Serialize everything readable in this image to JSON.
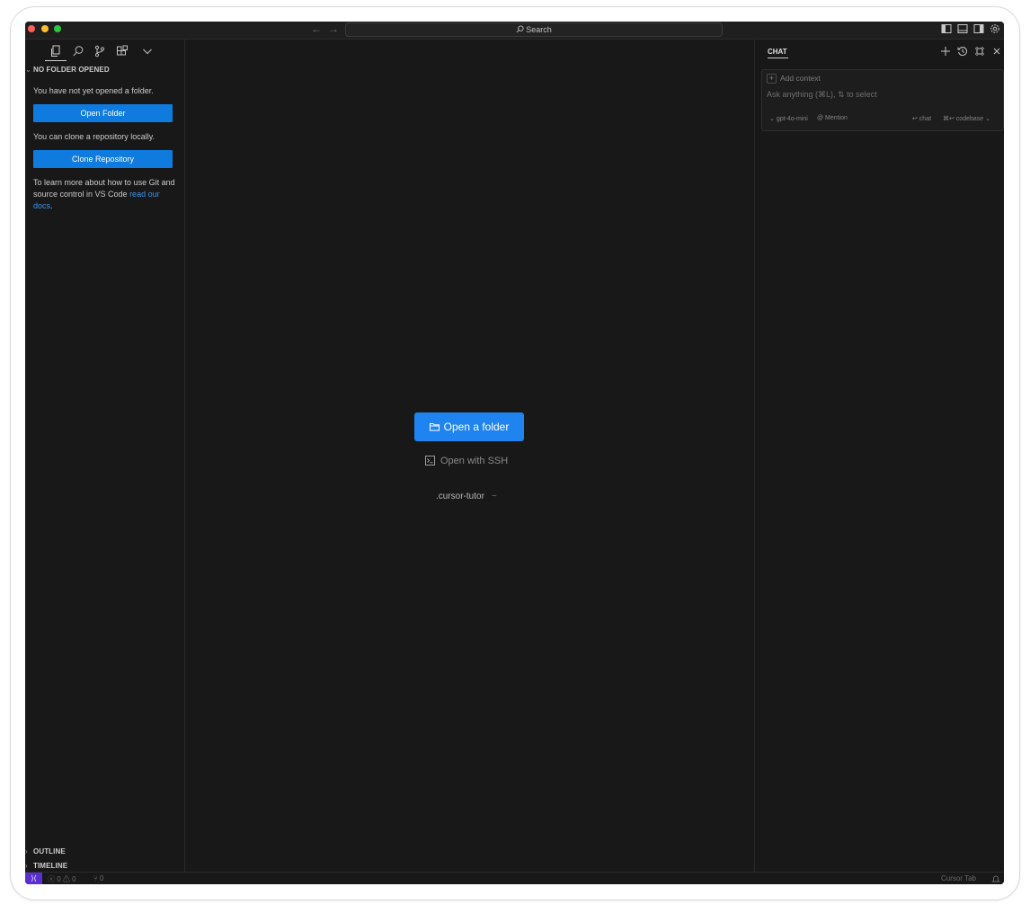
{
  "titlebar": {
    "back_arrow": "←",
    "forward_arrow": "→",
    "search_label": "Search",
    "right_icons": [
      "toggle-primary-sidebar-icon",
      "toggle-panel-icon",
      "toggle-secondary-sidebar-icon",
      "settings-gear-icon"
    ]
  },
  "activity_bar": {
    "icons": [
      "files-icon",
      "search-icon",
      "source-control-icon",
      "extensions-icon",
      "chevron-down-icon"
    ]
  },
  "sidebar": {
    "section_title": "NO FOLDER OPENED",
    "not_opened_text": "You have not yet opened a folder.",
    "open_folder_button": "Open Folder",
    "clone_text": "You can clone a repository locally.",
    "clone_button": "Clone Repository",
    "learn_text": "To learn more about how to use Git and source control in VS Code ",
    "learn_link": "read our docs",
    "learn_end": ".",
    "outline_title": "OUTLINE",
    "timeline_title": "TIMELINE"
  },
  "editor": {
    "open_folder_label": "Open a folder",
    "open_ssh_label": "Open with SSH",
    "recent_project": ".cursor-tutor",
    "recent_path": "~"
  },
  "chat": {
    "tab_title": "CHAT",
    "header_icons": [
      "new-chat-plus-icon",
      "history-icon",
      "maximize-icon",
      "close-icon"
    ],
    "add_context": "Add context",
    "placeholder": "Ask anything (⌘L), ⇅ to select",
    "model": "gpt-4o-mini",
    "mention": "@ Mention",
    "chat_shortcut": "↩ chat",
    "codebase_shortcut": "⌘↩ codebase"
  },
  "statusbar": {
    "errors": "0",
    "warnings": "0",
    "ports": "0",
    "right_label": "Cursor Tab"
  },
  "colors": {
    "accent": "#1f84f0",
    "background": "#181818",
    "remote_indicator": "#5a2fd1"
  }
}
